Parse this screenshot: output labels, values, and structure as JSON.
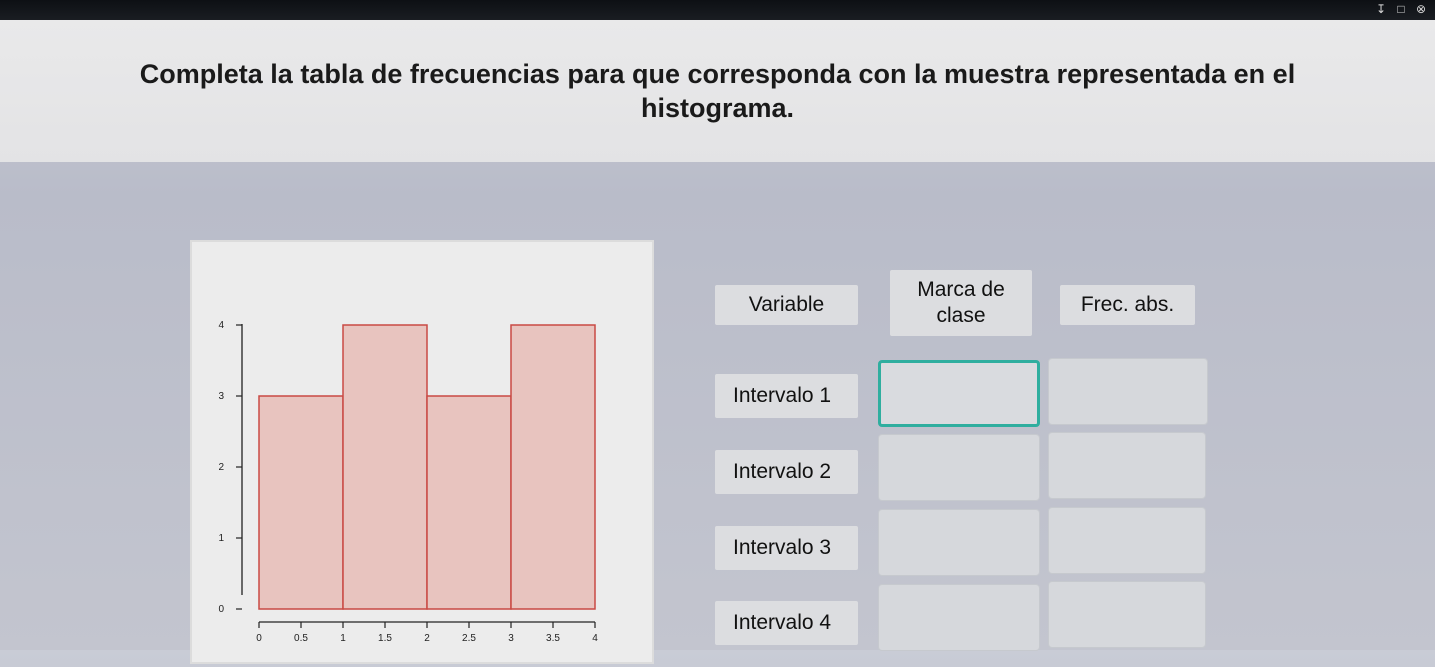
{
  "window_icons": [
    "pin-icon",
    "maximize-icon",
    "close-icon"
  ],
  "instruction": "Completa la tabla de frecuencias para que corresponda con la muestra representada en el histograma.",
  "table": {
    "headers": {
      "variable": "Variable",
      "marca_line1": "Marca de",
      "marca_line2": "clase",
      "frec": "Frec. abs."
    },
    "rows": [
      {
        "label": "Intervalo 1",
        "marca": "",
        "frec": ""
      },
      {
        "label": "Intervalo 2",
        "marca": "",
        "frec": ""
      },
      {
        "label": "Intervalo 3",
        "marca": "",
        "frec": ""
      },
      {
        "label": "Intervalo 4",
        "marca": "",
        "frec": ""
      }
    ]
  },
  "chart_data": {
    "type": "bar",
    "x_ticks": [
      "0",
      "0.5",
      "1",
      "1.5",
      "2",
      "2.5",
      "3",
      "3.5",
      "4"
    ],
    "y_ticks": [
      "0",
      "1",
      "2",
      "3",
      "4"
    ],
    "bins": [
      {
        "from": 0,
        "to": 1,
        "value": 3
      },
      {
        "from": 1,
        "to": 2,
        "value": 4
      },
      {
        "from": 2,
        "to": 3,
        "value": 3
      },
      {
        "from": 3,
        "to": 4,
        "value": 4
      }
    ],
    "xlim": [
      0,
      4
    ],
    "ylim": [
      0,
      4
    ],
    "bar_fill": "#e8c4bf",
    "bar_stroke": "#c94a44",
    "axis_color": "#222222"
  },
  "colors": {
    "focus": "#2fae9f"
  }
}
